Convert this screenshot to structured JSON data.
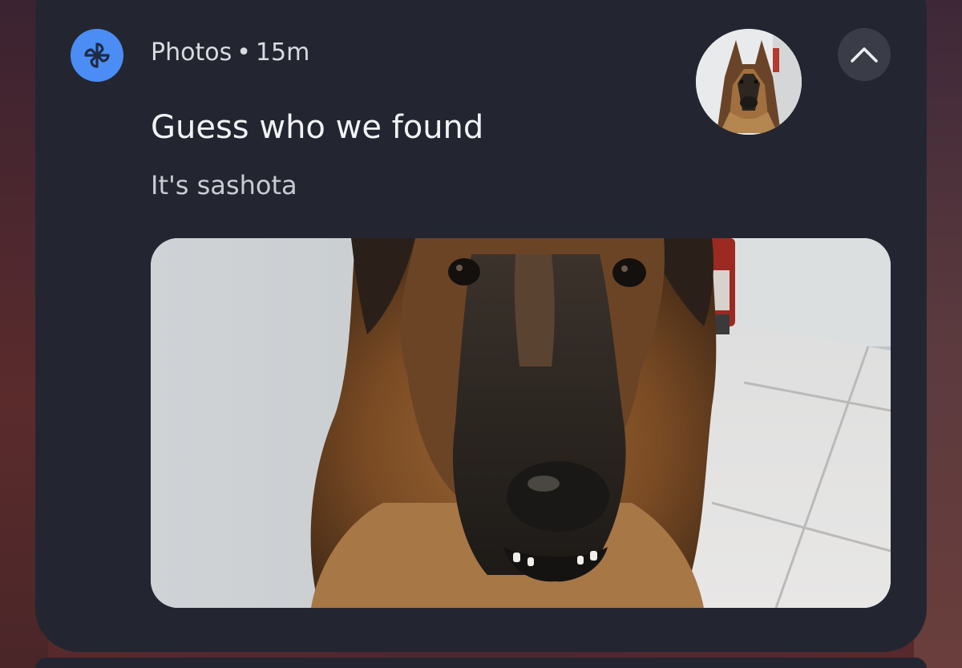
{
  "notification": {
    "app_name": "Photos",
    "separator": "•",
    "time_ago": "15m",
    "title": "Guess who we found",
    "body": "It's sashota",
    "icons": {
      "app_icon": "pinwheel-icon",
      "collapse": "chevron-up-icon"
    }
  },
  "colors": {
    "card_background": "#232630",
    "app_icon_background": "#4b8df5",
    "button_background": "#3a3d47",
    "title_text": "#f2f3f5",
    "secondary_text": "#c9ccd2"
  }
}
